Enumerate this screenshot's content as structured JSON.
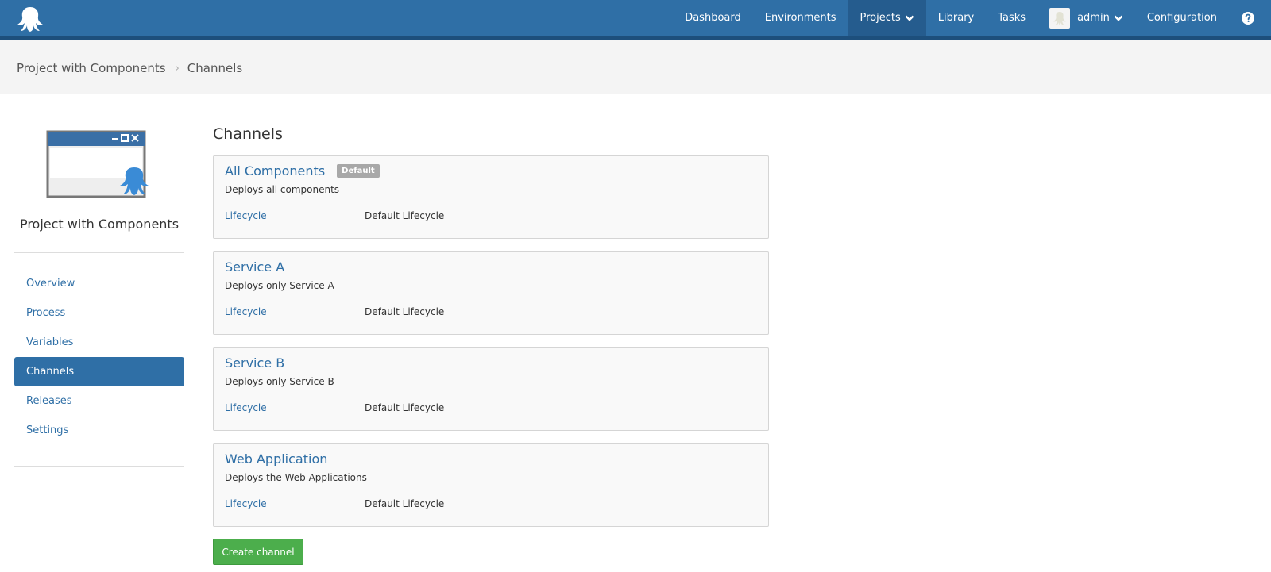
{
  "nav": {
    "logo_icon": "octopus-logo-icon",
    "items": [
      {
        "label": "Dashboard"
      },
      {
        "label": "Environments"
      },
      {
        "label": "Projects",
        "has_chevron": true,
        "active": true
      },
      {
        "label": "Library"
      },
      {
        "label": "Tasks"
      }
    ],
    "user": {
      "label": "admin",
      "avatar_icon": "user-avatar-icon"
    },
    "configuration": "Configuration",
    "help_icon": "question-circle-icon"
  },
  "breadcrumb": {
    "project": "Project with Components",
    "separator": "›",
    "current": "Channels"
  },
  "sidebar": {
    "project_name": "Project with Components",
    "logo_icon": "project-window-octopus-icon",
    "items": [
      {
        "label": "Overview"
      },
      {
        "label": "Process"
      },
      {
        "label": "Variables"
      },
      {
        "label": "Channels",
        "active": true
      },
      {
        "label": "Releases"
      },
      {
        "label": "Settings"
      }
    ]
  },
  "main": {
    "title": "Channels",
    "channels": [
      {
        "name": "All Components",
        "badge": "Default",
        "description": "Deploys all components",
        "lifecycle_label": "Lifecycle",
        "lifecycle_value": "Default Lifecycle"
      },
      {
        "name": "Service A",
        "badge": "",
        "description": "Deploys only Service A",
        "lifecycle_label": "Lifecycle",
        "lifecycle_value": "Default Lifecycle"
      },
      {
        "name": "Service B",
        "badge": "",
        "description": "Deploys only Service B",
        "lifecycle_label": "Lifecycle",
        "lifecycle_value": "Default Lifecycle"
      },
      {
        "name": "Web Application",
        "badge": "",
        "description": "Deploys the Web Applications",
        "lifecycle_label": "Lifecycle",
        "lifecycle_value": "Default Lifecycle"
      }
    ],
    "create_button": "Create channel"
  },
  "colors": {
    "brand_blue": "#2f6fa6",
    "nav_dark": "#1d4f7c",
    "success_green": "#4cae4c",
    "badge_gray": "#a8a8a8"
  }
}
